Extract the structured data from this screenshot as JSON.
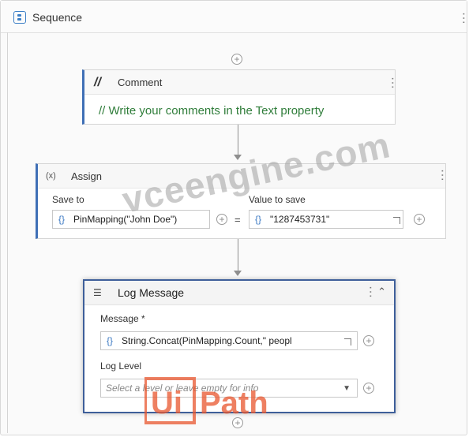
{
  "sequence": {
    "title": "Sequence",
    "icon": "sequence-icon"
  },
  "comment": {
    "title": "Comment",
    "glyph": "//",
    "text": "// Write your comments in the Text property"
  },
  "assign": {
    "title": "Assign",
    "glyph": "(x)",
    "save_to_label": "Save to",
    "save_to_value": "PinMapping(\"John Doe\")",
    "value_label": "Value to save",
    "value_value": "\"1287453731\"",
    "equals": "=",
    "brace": "{}"
  },
  "log_message": {
    "title": "Log Message",
    "message_label": "Message *",
    "message_value": "String.Concat(PinMapping.Count,\" peopl",
    "level_label": "Log Level",
    "level_placeholder": "Select a level or leave empty for info",
    "brace": "{}"
  },
  "watermarks": {
    "site": "vceengine.com",
    "logo": "UiPath"
  },
  "colors": {
    "accent": "#3f6fb6",
    "comment_text": "#2f7d3a",
    "logo": "#e8552d"
  }
}
